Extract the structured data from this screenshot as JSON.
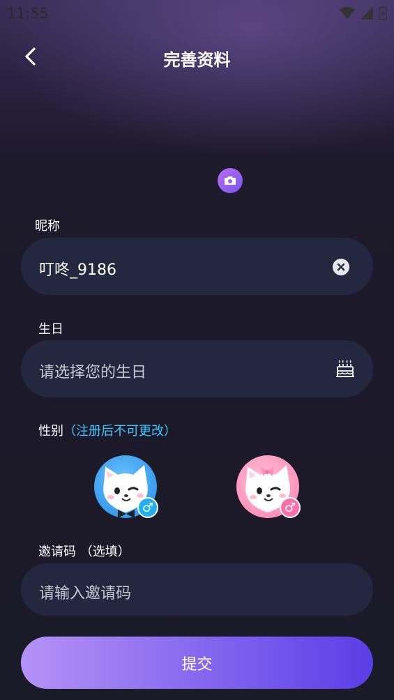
{
  "status_bar": {
    "time": "11:55"
  },
  "header": {
    "title": "完善资料"
  },
  "nickname": {
    "label": "昵称",
    "value": "叮咚_9186"
  },
  "birthday": {
    "label": "生日",
    "placeholder": "请选择您的生日"
  },
  "gender": {
    "label": "性别",
    "hint": "（注册后不可更改）",
    "male_symbol": "♂",
    "female_symbol": "♂"
  },
  "invite": {
    "label": "邀请码 （选填）",
    "placeholder": "请输入邀请码"
  },
  "submit": {
    "label": "提交"
  },
  "colors": {
    "accent_start": "#b592f5",
    "accent_end": "#5a3ee6",
    "hint": "#3fc8ff",
    "male": "#1fa4ef",
    "female": "#ff6fa8"
  }
}
